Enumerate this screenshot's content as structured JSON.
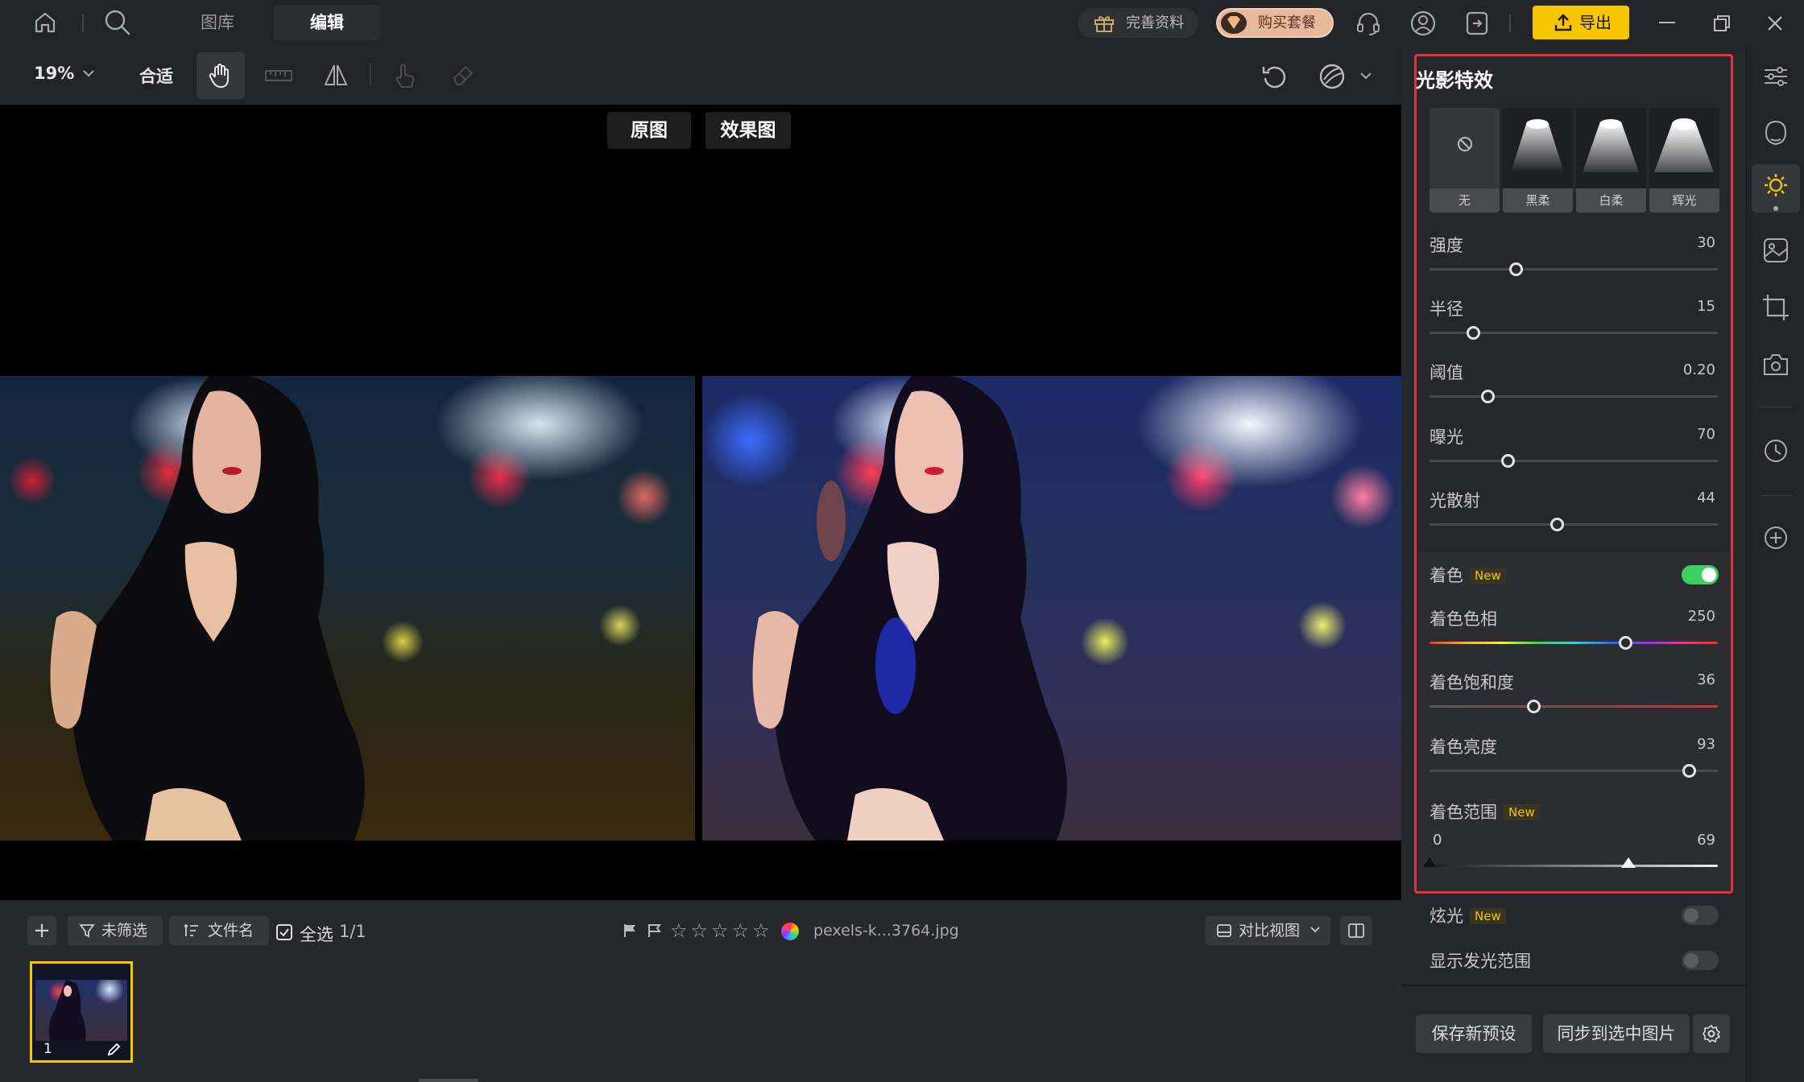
{
  "nav": {
    "library": "图库",
    "edit": "编辑",
    "complete_profile": "完善资料",
    "buy_package": "购买套餐",
    "export": "导出"
  },
  "toolbar": {
    "zoom": "19%",
    "fit": "合适"
  },
  "stage": {
    "original_label": "原图",
    "effect_label": "效果图"
  },
  "panel": {
    "title": "光影特效",
    "presets": [
      {
        "label": "无"
      },
      {
        "label": "黑柔"
      },
      {
        "label": "白柔"
      },
      {
        "label": "辉光"
      }
    ],
    "sliders": [
      {
        "label": "强度",
        "value": "30",
        "fraction": 0.3
      },
      {
        "label": "半径",
        "value": "15",
        "fraction": 0.15
      },
      {
        "label": "阈值",
        "value": "0.20",
        "fraction": 0.2
      },
      {
        "label": "曝光",
        "value": "70",
        "fraction": 0.27
      },
      {
        "label": "光散射",
        "value": "44",
        "fraction": 0.44
      }
    ],
    "tint": {
      "label": "着色",
      "badge": "New",
      "enabled": true,
      "hue": {
        "label": "着色色相",
        "value": "250",
        "fraction": 0.68
      },
      "saturation": {
        "label": "着色饱和度",
        "value": "36",
        "fraction": 0.36
      },
      "brightness": {
        "label": "着色亮度",
        "value": "93",
        "fraction": 0.9
      },
      "range": {
        "label": "着色范围",
        "badge": "New",
        "low": "0",
        "high": "69",
        "low_fraction": 0.0,
        "high_fraction": 0.69
      }
    },
    "flare": {
      "label": "炫光",
      "badge": "New",
      "enabled": false
    },
    "show_glow_range": {
      "label": "显示发光范围",
      "enabled": false
    },
    "save_preset": "保存新预设",
    "sync_selected": "同步到选中图片"
  },
  "strip": {
    "filter": "未筛选",
    "sort": "文件名",
    "select_all": "全选",
    "count": "1/1",
    "filename": "pexels-k...3764.jpg",
    "compare_view": "对比视图",
    "thumb_index": "1"
  },
  "colors": {
    "accent_yellow": "#f7c600",
    "highlight_red": "#e0333a",
    "toggle_on": "#3ccf5f"
  }
}
